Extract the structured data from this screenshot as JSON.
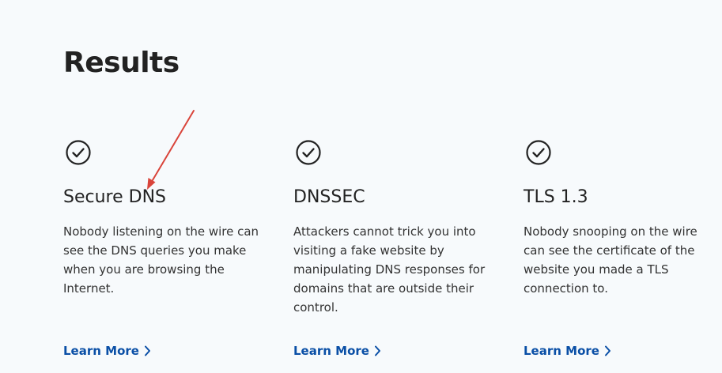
{
  "page": {
    "title": "Results"
  },
  "results": [
    {
      "icon": "check-circle-icon",
      "title": "Secure DNS",
      "description": "Nobody listening on the wire can see the DNS queries you make when you are browsing the Internet.",
      "link_label": "Learn More"
    },
    {
      "icon": "check-circle-icon",
      "title": "DNSSEC",
      "description": "Attackers cannot trick you into visiting a fake website by manipulating DNS responses for domains that are outside their control.",
      "link_label": "Learn More"
    },
    {
      "icon": "check-circle-icon",
      "title": "TLS 1.3",
      "description": "Nobody snooping on the wire can see the certificate of the website you made a TLS connection to.",
      "link_label": "Learn More"
    }
  ],
  "colors": {
    "background": "#f7fafc",
    "text": "#222222",
    "link": "#0a4fa6",
    "annotation_arrow": "#d9443a"
  }
}
